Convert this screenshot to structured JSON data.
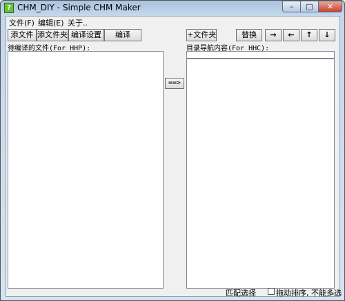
{
  "window": {
    "title": "CHM_DIY - Simple CHM Maker",
    "icon_glyph": "?",
    "minimize_glyph": "–",
    "maximize_glyph": "□",
    "close_glyph": "✕"
  },
  "menu": {
    "file": "文件(F)",
    "edit": "编辑(E)",
    "about": "关于.."
  },
  "toolbar": {
    "add_file": "添文件",
    "add_folder": "添文件夹",
    "compile_settings": "编译设置",
    "compile": "编译",
    "plus_folder": "+文件夹",
    "replace": "替换",
    "arrow_right": "→",
    "arrow_left": "←",
    "arrow_up": "↑",
    "arrow_down": "↓"
  },
  "left_panel": {
    "label": "待编译的文件(For HHP):"
  },
  "right_panel": {
    "label": "目录导航内容(For HHC):",
    "edit_value": ""
  },
  "transfer_button": "==>",
  "status": {
    "match_select": "匹配选择",
    "drag_sort": "拖动排序, 不能多选",
    "drag_sort_checked": false
  }
}
